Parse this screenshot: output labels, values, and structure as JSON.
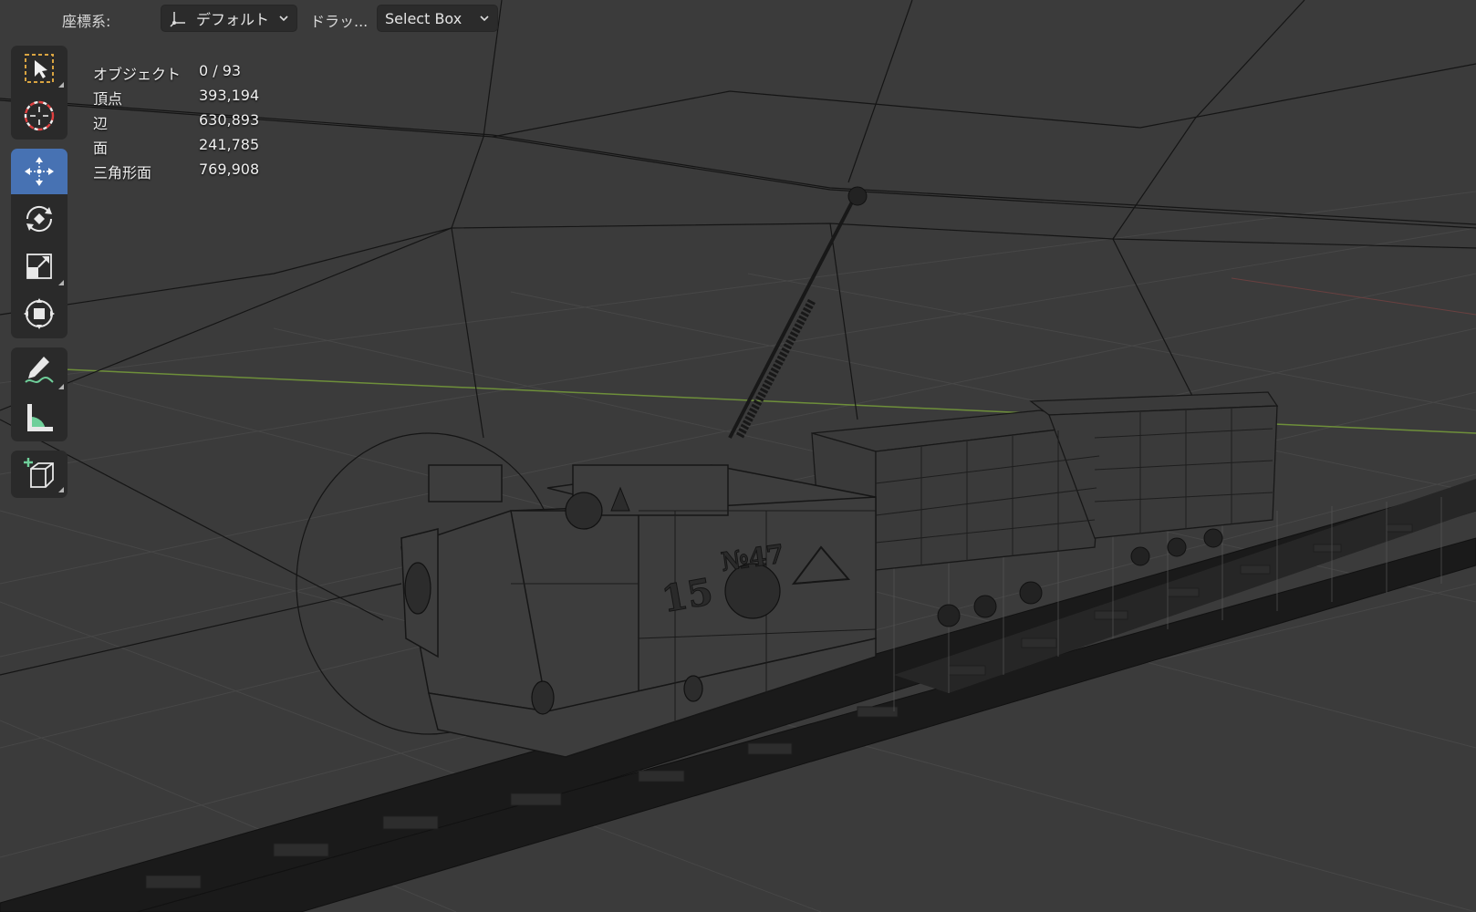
{
  "header": {
    "orientation_label": "座標系:",
    "orientation_value": "デフォルト",
    "drag_label": "ドラッ...",
    "drag_value": "Select Box",
    "orientation_icon": "transform-orientation-icon",
    "chevron_icon": "chevron-down-icon"
  },
  "toolbar": {
    "tools": [
      {
        "name": "select-box-tool",
        "icon": "select-box-icon",
        "active": false
      },
      {
        "name": "cursor-tool",
        "icon": "cursor-icon",
        "active": false
      },
      {
        "name": "move-tool",
        "icon": "move-icon",
        "active": true
      },
      {
        "name": "rotate-tool",
        "icon": "rotate-icon",
        "active": false
      },
      {
        "name": "scale-tool",
        "icon": "scale-icon",
        "active": false
      },
      {
        "name": "transform-tool",
        "icon": "transform-icon",
        "active": false
      },
      {
        "name": "annotate-tool",
        "icon": "annotate-icon",
        "active": false
      },
      {
        "name": "measure-tool",
        "icon": "measure-icon",
        "active": false
      },
      {
        "name": "add-cube-tool",
        "icon": "add-cube-icon",
        "active": false
      }
    ]
  },
  "stats": {
    "objects_label": "オブジェクト",
    "objects_value": "0 / 93",
    "vertices_label": "頂点",
    "vertices_value": "393,194",
    "edges_label": "辺",
    "edges_value": "630,893",
    "faces_label": "面",
    "faces_value": "241,785",
    "triangles_label": "三角形面",
    "triangles_value": "769,908"
  },
  "scene": {
    "loco_number": "15",
    "loco_badge": "№47"
  },
  "colors": {
    "viewport_bg": "#3b3b3b",
    "active_tool": "#4772b3",
    "wire": "#111111",
    "grid": "#4a4a4a",
    "y_axis": "#6e8f3a"
  }
}
